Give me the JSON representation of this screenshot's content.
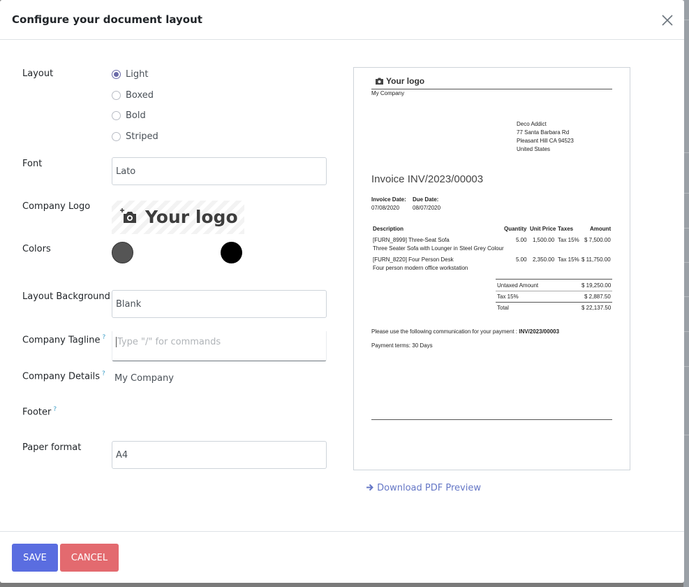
{
  "dialog": {
    "title": "Configure your document layout"
  },
  "form": {
    "layout": {
      "label": "Layout",
      "options": [
        "Light",
        "Boxed",
        "Bold",
        "Striped"
      ],
      "selected": "Light"
    },
    "font": {
      "label": "Font",
      "value": "Lato"
    },
    "company_logo": {
      "label": "Company Logo",
      "logo_text": "Your logo"
    },
    "colors": {
      "label": "Colors",
      "primary": "#555555",
      "secondary": "#000000"
    },
    "layout_background": {
      "label": "Layout Background",
      "value": "Blank"
    },
    "company_tagline": {
      "label": "Company Tagline",
      "help": "?",
      "placeholder": "Type \"/\" for commands"
    },
    "company_details": {
      "label": "Company Details",
      "help": "?",
      "value": "My Company"
    },
    "footer": {
      "label": "Footer",
      "help": "?"
    },
    "paper_format": {
      "label": "Paper format",
      "value": "A4"
    }
  },
  "preview": {
    "logo_text": "Your logo",
    "company_name": "My Company",
    "address": [
      "Deco Addict",
      "77 Santa Barbara Rd",
      "Pleasant Hill CA 94523",
      "United States"
    ],
    "invoice_title": "Invoice INV/2023/00003",
    "invoice_date_label": "Invoice Date:",
    "invoice_date": "07/08/2020",
    "due_date_label": "Due Date:",
    "due_date": "08/07/2020",
    "columns": [
      "Description",
      "Quantity",
      "Unit Price",
      "Taxes",
      "Amount"
    ],
    "lines": [
      {
        "description": "[FURN_8999] Three-Seat Sofa",
        "note": "Three Seater Sofa with Lounger in Steel Grey Colour",
        "quantity": "5.00",
        "unit_price": "1,500.00",
        "taxes": "Tax 15%",
        "amount": "$ 7,500.00"
      },
      {
        "description": "[FURN_8220] Four Person Desk",
        "note": "Four person modern office workstation",
        "quantity": "5.00",
        "unit_price": "2,350.00",
        "taxes": "Tax 15%",
        "amount": "$ 11,750.00"
      }
    ],
    "totals": [
      {
        "label": "Untaxed Amount",
        "value": "$ 19,250.00"
      },
      {
        "label": "Tax 15%",
        "value": "$ 2,887.50"
      },
      {
        "label": "Total",
        "value": "$ 22,137.50"
      }
    ],
    "communication_text": "Please use the following communication for your payment : ",
    "communication_ref": "INV/2023/00003",
    "payment_terms": "Payment terms: 30 Days"
  },
  "download_link": "Download PDF Preview",
  "buttons": {
    "save": "SAVE",
    "cancel": "CANCEL"
  },
  "theme": {
    "accent": "#5a6de0",
    "danger": "#e36a6f",
    "link": "#6577c6"
  }
}
